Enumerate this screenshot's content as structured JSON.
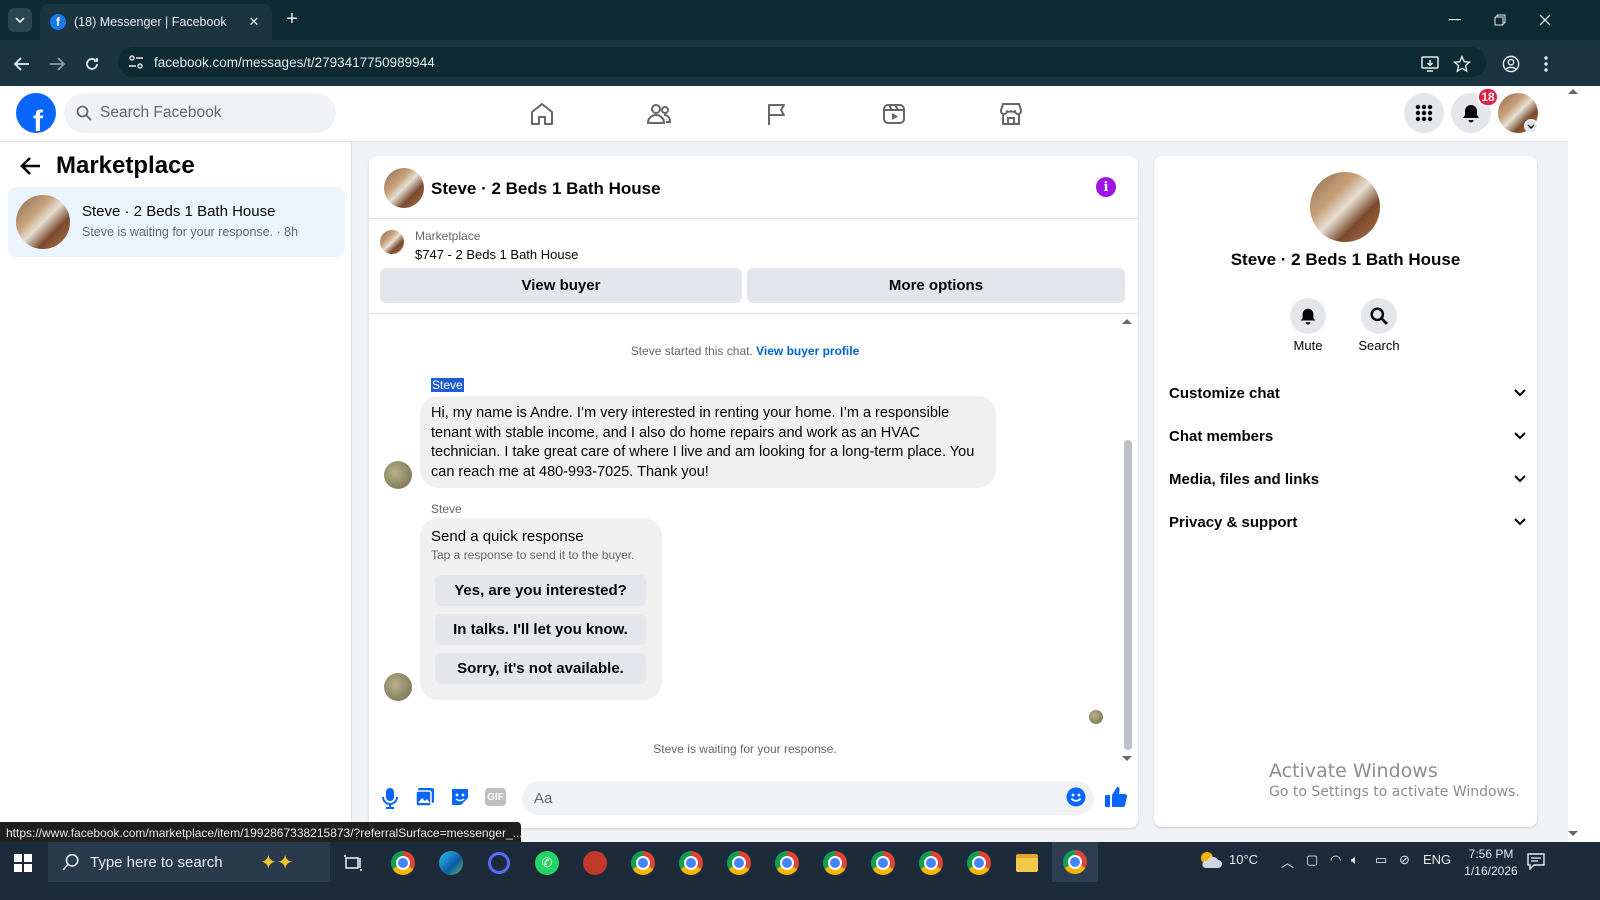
{
  "browser": {
    "tab_title": "(18) Messenger | Facebook",
    "url": "facebook.com/messages/t/2793417750989944",
    "status_url": "https://www.facebook.com/marketplace/item/1992867338215873/?referralSurface=messenger_..."
  },
  "header": {
    "search_placeholder": "Search Facebook",
    "notification_count": "18",
    "nav_icons": [
      "home-icon",
      "friends-icon",
      "pages-flag-icon",
      "video-icon",
      "marketplace-icon"
    ]
  },
  "left": {
    "title": "Marketplace",
    "conversation": {
      "name": "Steve · 2 Beds 1 Bath House",
      "preview": "Steve is waiting for your response. · 8h"
    }
  },
  "chat": {
    "title": "Steve · 2 Beds 1 Bath House",
    "listing": {
      "label": "Marketplace",
      "price_title": "$747 - 2 Beds 1 Bath House"
    },
    "view_buyer_label": "View buyer",
    "more_options_label": "More options",
    "started_text": "Steve started this chat.",
    "view_profile_link": "View buyer profile",
    "sender_name_1": "Steve",
    "message": "Hi, my name is Andre. I’m very interested in renting your home. I’m a responsible tenant with stable income, and I also do home repairs and work as an HVAC technician. I take great care of where I live and am looking for a long-term place. You can reach me at 480-993-7025. Thank you!",
    "sender_name_2": "Steve",
    "quick": {
      "title": "Send a quick response",
      "subtitle": "Tap a response to send it to the buyer.",
      "options": [
        "Yes, are you interested?",
        "In talks. I'll let you know.",
        "Sorry, it's not available."
      ]
    },
    "waiting_text": "Steve is waiting for your response.",
    "compose_placeholder": "Aa"
  },
  "right": {
    "name": "Steve · 2 Beds 1 Bath House",
    "mute_label": "Mute",
    "search_label": "Search",
    "sections": [
      "Customize chat",
      "Chat members",
      "Media, files and links",
      "Privacy & support"
    ]
  },
  "watermark": {
    "line1": "Activate Windows",
    "line2": "Go to Settings to activate Windows."
  },
  "taskbar": {
    "search_placeholder": "Type here to search",
    "weather": "10°C",
    "language": "ENG",
    "time": "7:56 PM",
    "date": "1/16/2026"
  },
  "colors": {
    "facebook_blue": "#0866ff",
    "info_purple": "#9f15e8",
    "badge_red": "#e41e3f",
    "selected_conversation": "#ebf5ff"
  }
}
